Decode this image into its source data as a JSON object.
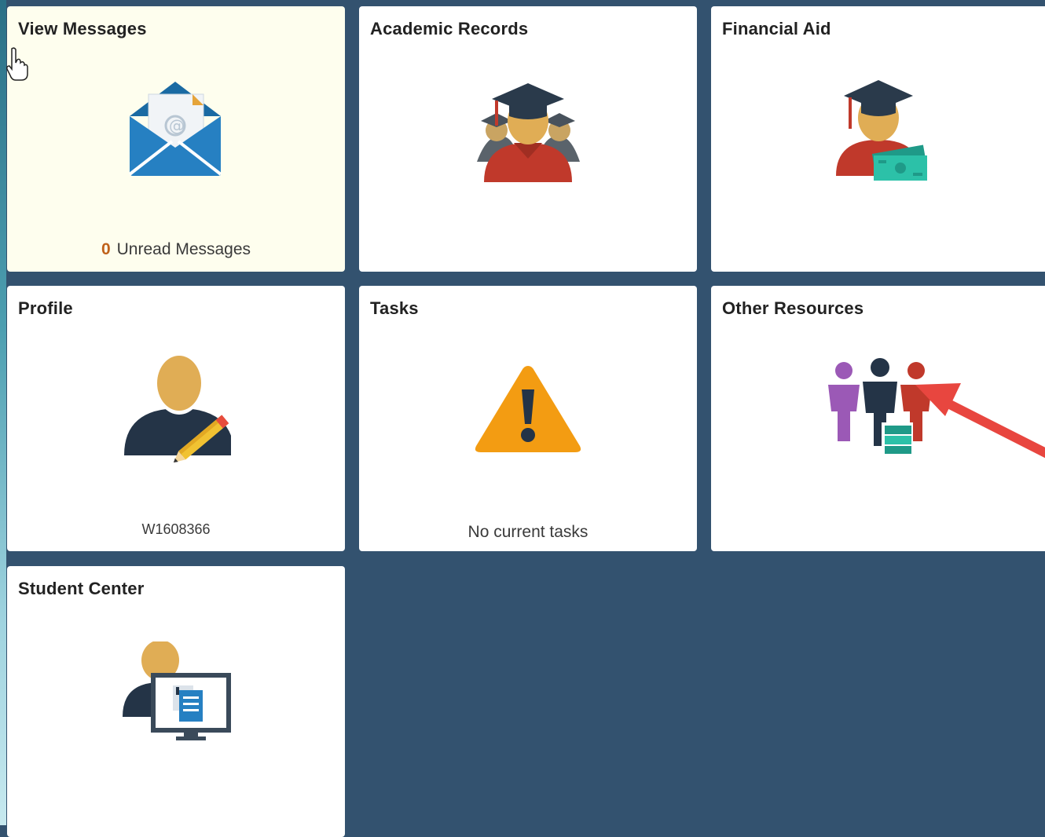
{
  "tiles": {
    "view_messages": {
      "title": "View Messages",
      "count": "0",
      "footer": "Unread Messages",
      "icon": "envelope-icon"
    },
    "academic_records": {
      "title": "Academic Records",
      "icon": "graduates-icon"
    },
    "financial_aid": {
      "title": "Financial Aid",
      "icon": "graduate-money-icon"
    },
    "profile": {
      "title": "Profile",
      "footer": "W1608366",
      "icon": "user-edit-icon"
    },
    "tasks": {
      "title": "Tasks",
      "footer": "No current tasks",
      "icon": "warning-icon"
    },
    "other_resources": {
      "title": "Other Resources",
      "icon": "people-group-icon"
    },
    "student_center": {
      "title": "Student Center",
      "icon": "student-computer-icon"
    }
  },
  "colors": {
    "background": "#33526f",
    "tile": "#ffffff",
    "tile_highlight": "#fefeee",
    "count": "#c0621b",
    "arrow": "#e8463f"
  }
}
